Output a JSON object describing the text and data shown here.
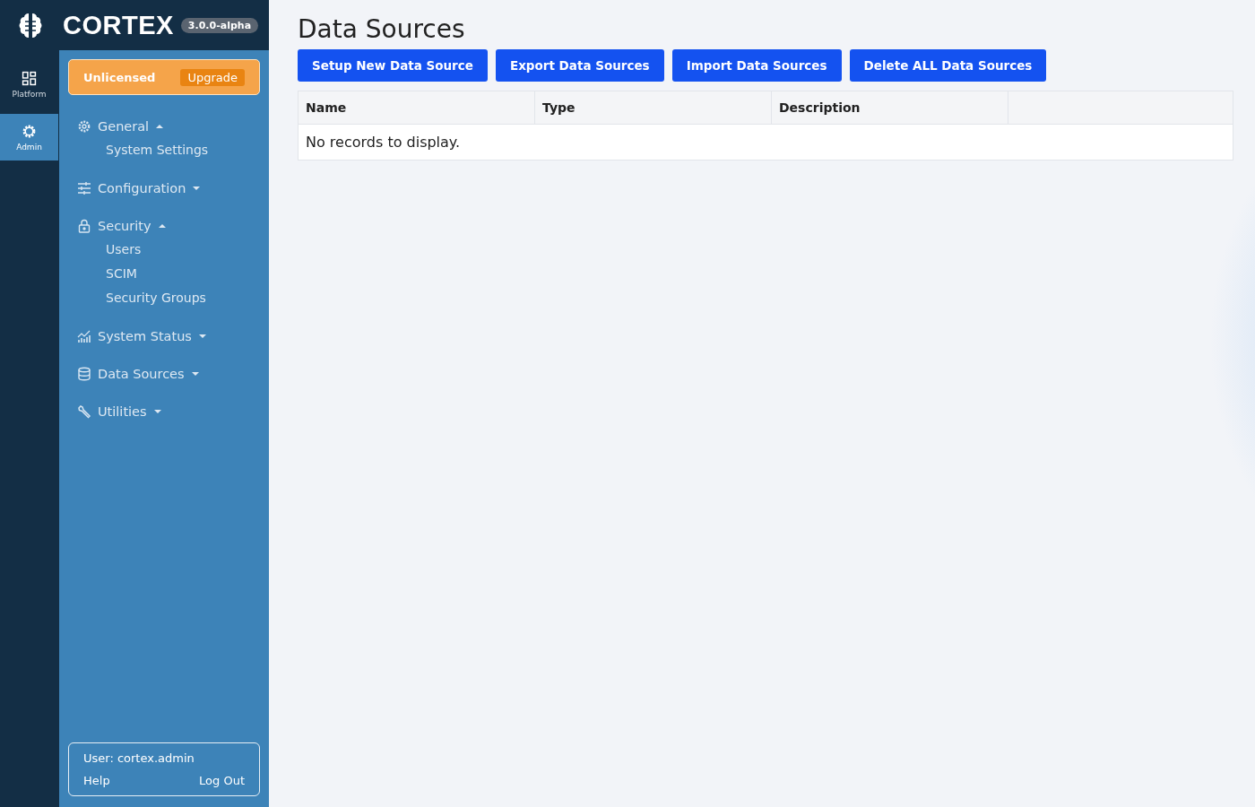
{
  "brand": {
    "name": "CORTEX",
    "version": "3.0.0-alpha"
  },
  "rail": [
    {
      "label": "Platform",
      "kind": "grid",
      "selected": false
    },
    {
      "label": "Admin",
      "kind": "gear",
      "selected": true
    }
  ],
  "license": {
    "status": "Unlicensed",
    "action": "Upgrade"
  },
  "nav": [
    {
      "label": "General",
      "kind": "gear",
      "expanded": true,
      "children": [
        {
          "label": "System Settings"
        }
      ]
    },
    {
      "label": "Configuration",
      "kind": "sliders",
      "expanded": false
    },
    {
      "label": "Security",
      "kind": "lock",
      "expanded": true,
      "children": [
        {
          "label": "Users"
        },
        {
          "label": "SCIM"
        },
        {
          "label": "Security Groups"
        }
      ]
    },
    {
      "label": "System Status",
      "kind": "chart",
      "expanded": false
    },
    {
      "label": "Data Sources",
      "kind": "database",
      "expanded": false
    },
    {
      "label": "Utilities",
      "kind": "wrench",
      "expanded": false
    }
  ],
  "user": {
    "label": "User: cortex.admin",
    "help": "Help",
    "logout": "Log Out"
  },
  "page": {
    "title": "Data Sources",
    "buttons": [
      "Setup New Data Source",
      "Export Data Sources",
      "Import Data Sources",
      "Delete ALL Data Sources"
    ],
    "table": {
      "columns": [
        "Name",
        "Type",
        "Description"
      ],
      "empty": "No records to display."
    }
  }
}
